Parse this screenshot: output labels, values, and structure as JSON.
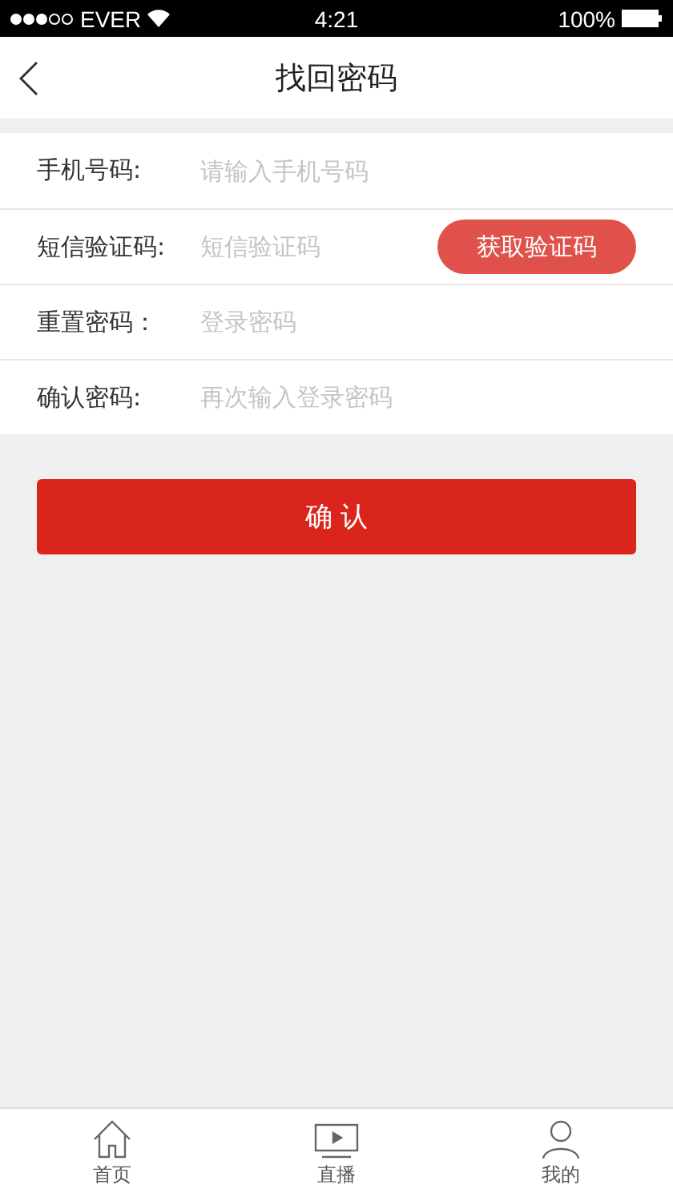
{
  "status_bar": {
    "carrier": "EVER",
    "time": "4:21",
    "battery": "100%"
  },
  "nav": {
    "title": "找回密码"
  },
  "form": {
    "rows": [
      {
        "kind": "input",
        "label": "手机号码:",
        "placeholder": "请输入手机号码"
      },
      {
        "kind": "code",
        "label": "短信验证码:",
        "placeholder": "短信验证码",
        "button": "获取验证码"
      },
      {
        "kind": "input",
        "label": "重置密码：",
        "placeholder": "登录密码"
      },
      {
        "kind": "input",
        "label": "确认密码:",
        "placeholder": "再次输入登录密码"
      }
    ]
  },
  "submit": "确 认",
  "tab_bar": {
    "items": [
      {
        "kind": "home",
        "label": "首页"
      },
      {
        "kind": "live",
        "label": "直播"
      },
      {
        "kind": "me",
        "label": "我的"
      }
    ]
  }
}
